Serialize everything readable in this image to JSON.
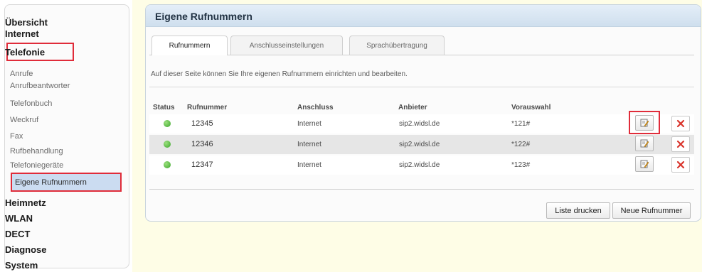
{
  "nav": {
    "top1": "Übersicht",
    "top2": "Internet",
    "top3": "Telefonie",
    "telefonie_sub": [
      "Anrufe",
      "Anrufbeantworter",
      "Telefonbuch",
      "Weckruf",
      "Fax",
      "Rufbehandlung",
      "Telefoniegeräte",
      "Eigene Rufnummern"
    ],
    "bottom": [
      "Heimnetz",
      "WLAN",
      "DECT",
      "Diagnose",
      "System"
    ]
  },
  "panel": {
    "title": "Eigene Rufnummern",
    "tabs": [
      "Rufnummern",
      "Anschlusseinstellungen",
      "Sprachübertragung"
    ],
    "description": "Auf dieser Seite können Sie Ihre eigenen Rufnummern einrichten und bearbeiten."
  },
  "table": {
    "headers": [
      "Status",
      "Rufnummer",
      "Anschluss",
      "Anbieter",
      "Vorauswahl"
    ],
    "rows": [
      [
        "12345",
        "Internet",
        "sip2.widsl.de",
        "*121#"
      ],
      [
        "12346",
        "Internet",
        "sip2.widsl.de",
        "*122#"
      ],
      [
        "12347",
        "Internet",
        "sip2.widsl.de",
        "*123#"
      ]
    ]
  },
  "buttons": {
    "print": "Liste drucken",
    "new": "Neue Rufnummer"
  },
  "icons": {
    "status": "status-dot-icon",
    "edit": "edit-icon",
    "delete": "delete-icon"
  },
  "colors": {
    "highlight": "#e02c3a",
    "status_ok": "#3aa52a",
    "active_nav": "#cbdcf1",
    "delete": "#d9342b"
  }
}
